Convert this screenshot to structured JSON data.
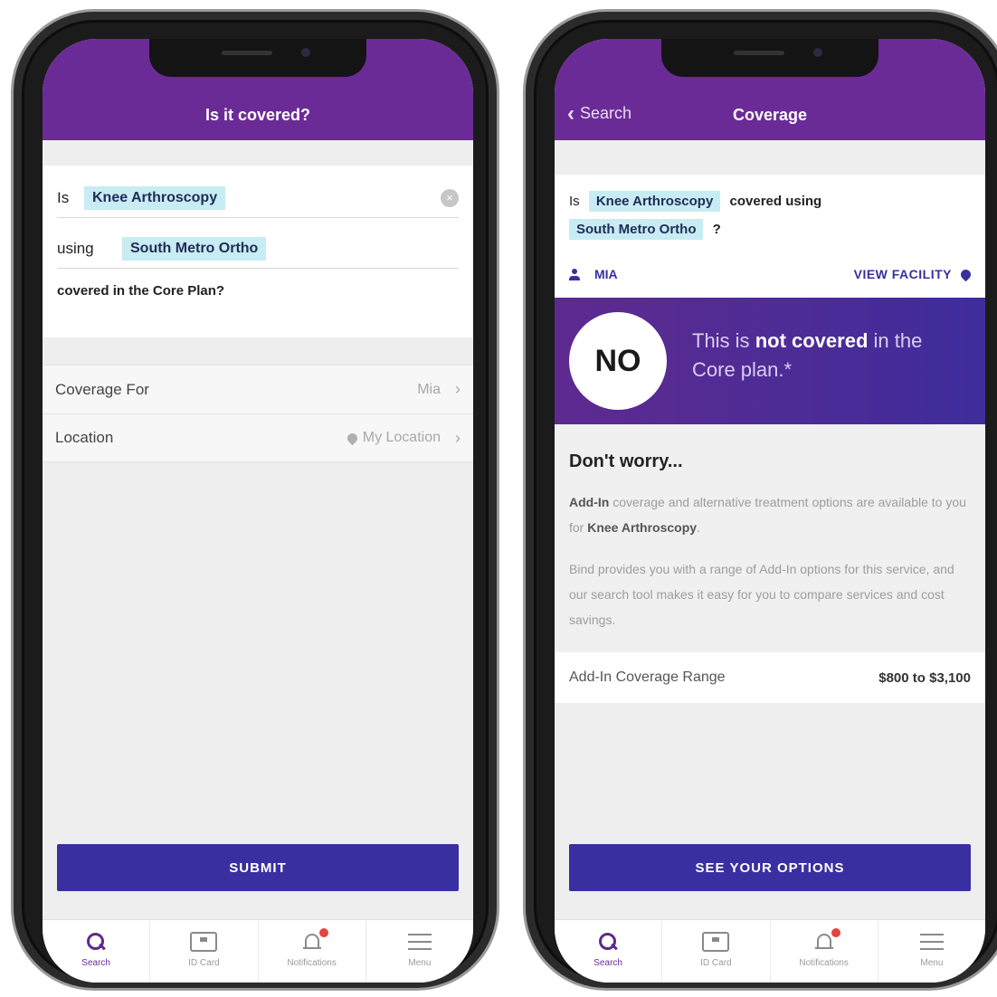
{
  "left_screen": {
    "header": {
      "title": "Is it covered?"
    },
    "question": {
      "prefix": "Is",
      "procedure": "Knee Arthroscopy",
      "clear_icon": "x-circle-icon",
      "using_word": "using",
      "provider": "South Metro Ortho",
      "suffix": "covered in the Core Plan?"
    },
    "options": [
      {
        "label": "Coverage For",
        "value": "Mia"
      },
      {
        "label": "Location",
        "value": "My Location"
      }
    ],
    "submit_label": "SUBMIT"
  },
  "right_screen": {
    "header": {
      "back_label": "Search",
      "title": "Coverage"
    },
    "question": {
      "prefix": "Is",
      "procedure": "Knee Arthroscopy",
      "middle": "covered using",
      "provider": "South Metro Ortho",
      "end": "?"
    },
    "member": "MIA",
    "view_facility": "VIEW FACILITY",
    "verdict": {
      "answer": "NO",
      "pre": "This is ",
      "bold": "not covered",
      "post": " in the Core plan.*"
    },
    "worry": {
      "title": "Don't worry...",
      "p1_bold1": "Add-In",
      "p1_mid": " coverage and alternative treatment options are available to you for ",
      "p1_bold2": "Knee Arthroscopy",
      "p1_end": ".",
      "p2": "Bind provides you with a range of Add-In options for this service, and our search tool makes it easy for you to compare services and cost savings."
    },
    "range": {
      "label": "Add-In Coverage Range",
      "value": "$800 to $3,100"
    },
    "button_label": "SEE YOUR OPTIONS"
  },
  "tabbar": [
    {
      "label": "Search",
      "icon": "search-icon"
    },
    {
      "label": "ID Card",
      "icon": "id-card-icon"
    },
    {
      "label": "Notifications",
      "icon": "bell-icon"
    },
    {
      "label": "Menu",
      "icon": "menu-icon"
    }
  ],
  "colors": {
    "header_purple": "#6b2b97",
    "button_indigo": "#3a2fa0",
    "chip_cyan": "#c8ecf3",
    "notification_red": "#e8423c"
  }
}
